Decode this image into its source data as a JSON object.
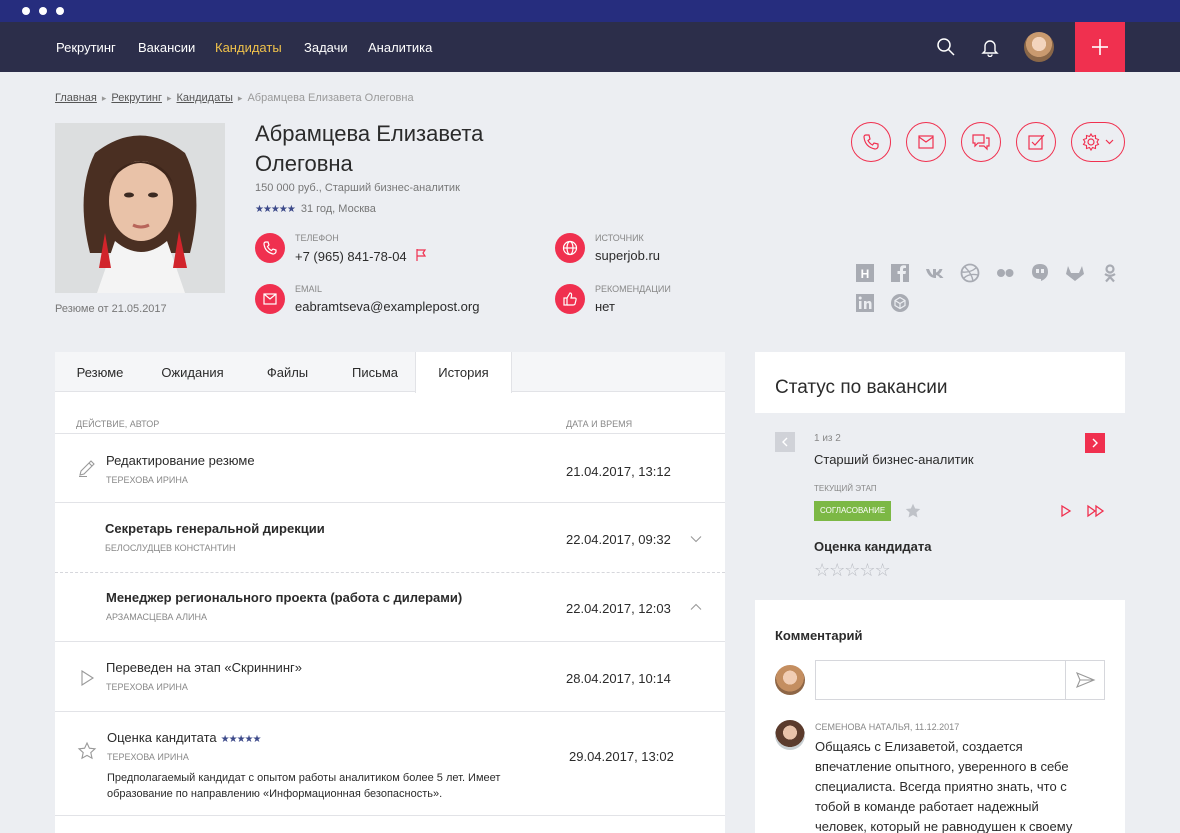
{
  "nav": {
    "items": [
      "Рекрутинг",
      "Вакансии",
      "Кандидаты",
      "Задачи",
      "Аналитика"
    ],
    "active_index": 2
  },
  "breadcrumb": {
    "items": [
      "Главная",
      "Рекрутинг",
      "Кандидаты"
    ],
    "current": "Абрамцева Елизавета Олеговна"
  },
  "candidate": {
    "name": "Абрамцева Елизавета Олеговна",
    "subtitle": "150 000 руб., Старший бизнес-аналитик",
    "rating_stars": "★★★★★",
    "age_city": "31 год, Москва",
    "resume_date": "Резюме от 21.05.2017",
    "phone_label": "ТЕЛЕФОН",
    "phone": "+7 (965) 841-78-04",
    "email_label": "EMAIL",
    "email": "eabramtseva@examplepost.org",
    "source_label": "ИСТОЧНИК",
    "source": "superjob.ru",
    "recommend_label": "РЕКОМЕНДАЦИИ",
    "recommend": "нет"
  },
  "social": [
    "hh",
    "facebook",
    "vk",
    "dribbble",
    "flickr",
    "hangouts",
    "gitlab",
    "odnoklassniki",
    "linkedin",
    "codepen"
  ],
  "tabs": [
    "Резюме",
    "Ожидания",
    "Файлы",
    "Письма",
    "История"
  ],
  "active_tab": 4,
  "history": {
    "col_action": "ДЕЙСТВИЕ, АВТОР",
    "col_date": "ДАТА И ВРЕМЯ",
    "rows": [
      {
        "title": "Редактирование резюме",
        "author": "ТЕРЕХОВА ИРИНА",
        "date": "21.04.2017, 13:12"
      },
      {
        "title": "Секретарь генеральной дирекции",
        "author": "БЕЛОСЛУДЦЕВ КОНСТАНТИН",
        "date": "22.04.2017, 09:32"
      },
      {
        "title": "Менеджер регионального проекта (работа с дилерами)",
        "author": "АРЗАМАСЦЕВА АЛИНА",
        "date": "22.04.2017, 12:03"
      },
      {
        "title": "Переведен на этап «Скриннинг»",
        "author": "ТЕРЕХОВА ИРИНА",
        "date": "28.04.2017, 10:14"
      },
      {
        "title": "Оценка кандитата",
        "stars": "★★★★★",
        "author": "ТЕРЕХОВА ИРИНА",
        "date": "29.04.2017, 13:02",
        "desc": "Предполагаемый кандидат с опытом работы аналитиком более 5 лет. Имеет образование по направлению «Информационная безопасность»."
      }
    ]
  },
  "status": {
    "title": "Статус по вакансии",
    "pager": "1 из 2",
    "vacancy": "Старший бизнес-аналитик",
    "stage_label": "ТЕКУЩИЙ ЭТАП",
    "stage": "СОГЛАСОВАНИЕ",
    "eval_title": "Оценка кандидата",
    "eval_stars": "☆☆☆☆☆"
  },
  "comments": {
    "title": "Комментарий",
    "author": "СЕМЕНОВА НАТАЛЬЯ, 11.12.2017",
    "text": "Общаясь с Елизаветой, создается впечатление опытного, уверенного в себе специалиста. Всегда приятно знать, что с тобой в команде работает надежный человек, который не равнодушен к своему"
  },
  "colors": {
    "accent": "#f0304f",
    "nav_bg": "#2c2e4a",
    "chrome": "#262d7e",
    "active_nav": "#f0c24b",
    "stage": "#7cb845"
  }
}
